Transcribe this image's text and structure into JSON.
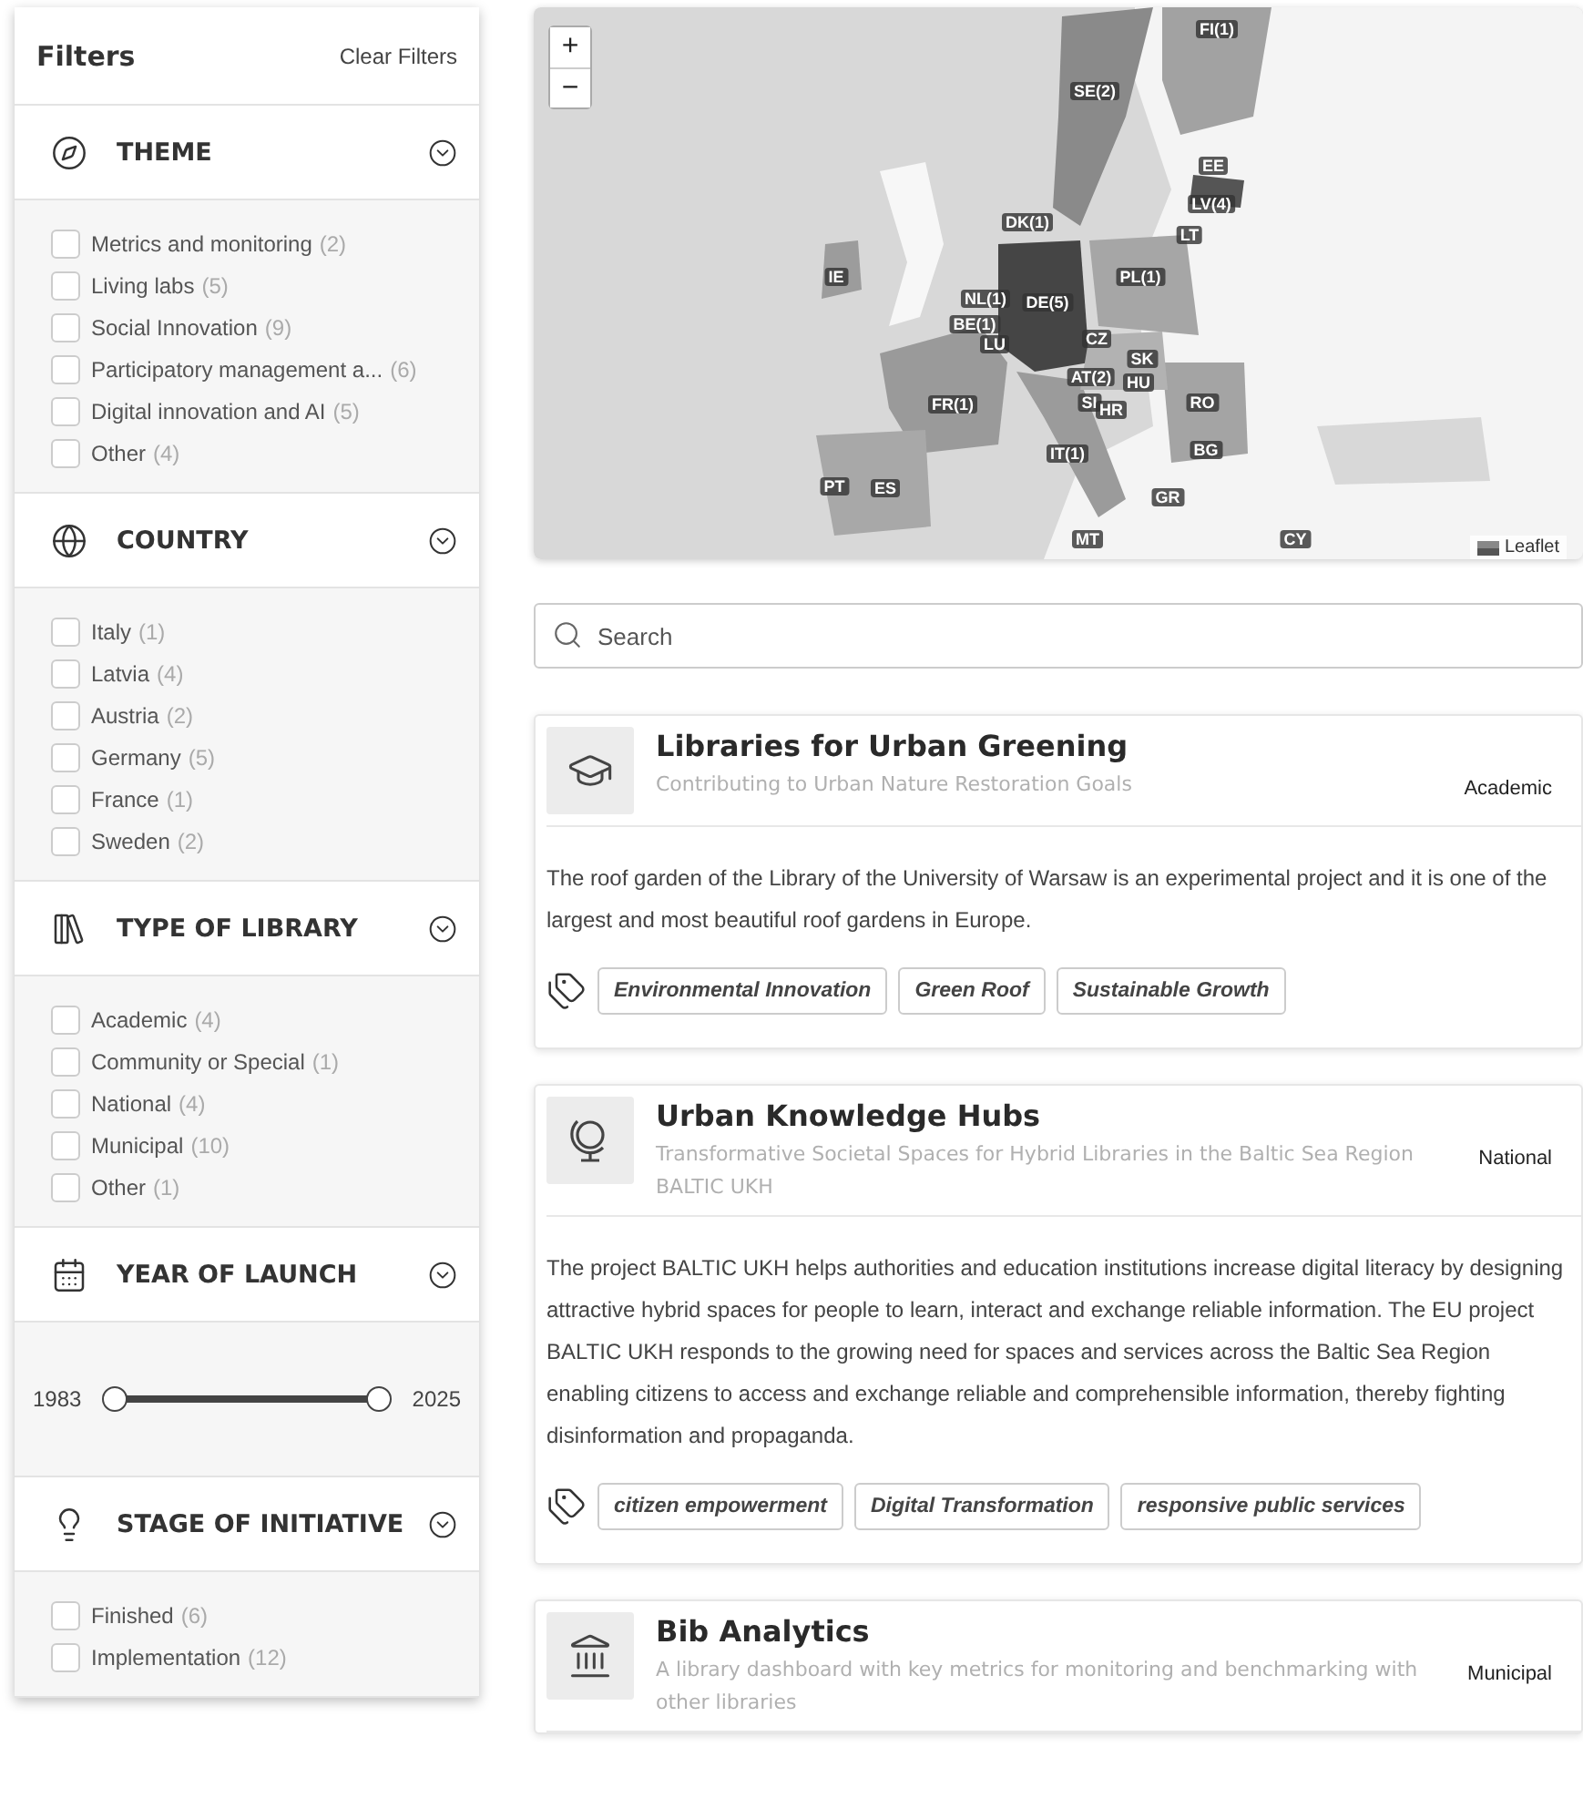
{
  "filters": {
    "title": "Filters",
    "clear": "Clear Filters"
  },
  "sections": [
    {
      "kind": "checklist",
      "title": "THEME",
      "expanded": true,
      "items": [
        {
          "label": "Metrics and monitoring",
          "count": "(2)",
          "checked": false
        },
        {
          "label": "Living labs",
          "count": "(5)",
          "checked": false
        },
        {
          "label": "Social Innovation",
          "count": "(9)",
          "checked": false
        },
        {
          "label": "Participatory management a...",
          "count": "(6)",
          "checked": false
        },
        {
          "label": "Digital innovation and AI",
          "count": "(5)",
          "checked": false
        },
        {
          "label": "Other",
          "count": "(4)",
          "checked": false
        }
      ]
    },
    {
      "kind": "checklist",
      "title": "COUNTRY",
      "expanded": true,
      "items": [
        {
          "label": "Italy",
          "count": "(1)",
          "checked": false
        },
        {
          "label": "Latvia",
          "count": "(4)",
          "checked": false
        },
        {
          "label": "Austria",
          "count": "(2)",
          "checked": false
        },
        {
          "label": "Germany",
          "count": "(5)",
          "checked": false
        },
        {
          "label": "France",
          "count": "(1)",
          "checked": false
        },
        {
          "label": "Sweden",
          "count": "(2)",
          "checked": false
        }
      ]
    },
    {
      "kind": "checklist",
      "title": "TYPE OF LIBRARY",
      "expanded": true,
      "items": [
        {
          "label": "Academic",
          "count": "(4)",
          "checked": false
        },
        {
          "label": "Community or Special",
          "count": "(1)",
          "checked": false
        },
        {
          "label": "National",
          "count": "(4)",
          "checked": false
        },
        {
          "label": "Municipal",
          "count": "(10)",
          "checked": false
        },
        {
          "label": "Other",
          "count": "(1)",
          "checked": false
        }
      ]
    },
    {
      "kind": "range",
      "title": "YEAR OF LAUNCH",
      "expanded": true,
      "slider": {
        "min_label": "1983",
        "max_label": "2025",
        "handles": [
          {
            "level": 0
          },
          {
            "level": 1
          }
        ]
      }
    },
    {
      "kind": "checklist",
      "title": "STAGE OF INITIATIVE",
      "expanded": true,
      "items": [
        {
          "label": "Finished",
          "count": "(6)",
          "checked": false
        },
        {
          "label": "Implementation",
          "count": "(12)",
          "checked": false
        }
      ]
    }
  ],
  "map": {
    "zoom_in": "+",
    "zoom_out": "−",
    "attribution": "Leaflet",
    "labels": [
      "FI(1)",
      "SE(2)",
      "EE",
      "LV(4)",
      "DK(1)",
      "LT",
      "IE",
      "PL(1)",
      "NL(1)",
      "DE(5)",
      "BE(1)",
      "LU",
      "CZ",
      "SK",
      "AT(2)",
      "HU",
      "FR(1)",
      "SI",
      "HR",
      "RO",
      "IT(1)",
      "BG",
      "PT",
      "ES",
      "GR",
      "MT",
      "CY"
    ]
  },
  "search": {
    "placeholder": "Search"
  },
  "cards": [
    {
      "title": "Libraries for Urban Greening",
      "subtitle": "Contributing to Urban Nature Restoration Goals",
      "type": "Academic",
      "description": "The roof garden of the Library of the University of Warsaw is an experimental project and it is one of the largest and most beautiful roof gardens in Europe.",
      "tags": [
        "Environmental Innovation",
        "Green Roof",
        "Sustainable Growth"
      ]
    },
    {
      "title": "Urban Knowledge Hubs",
      "subtitle": "Transformative Societal Spaces for Hybrid Libraries in the Baltic Sea Region BALTIC UKH",
      "type": "National",
      "description": "The project BALTIC UKH helps authorities and education institutions increase digital literacy by designing attractive hybrid spaces for people to learn, interact and exchange reliable information. The EU project BALTIC UKH responds to the growing need for spaces and services across the Baltic Sea Region enabling citizens to access and exchange reliable and comprehensible information, thereby fighting disinformation and propaganda.",
      "tags": [
        "citizen empowerment",
        "Digital Transformation",
        "responsive public services"
      ]
    },
    {
      "title": "Bib Analytics",
      "subtitle": "A library dashboard with key metrics for monitoring and benchmarking with other libraries",
      "type": "Municipal"
    }
  ]
}
